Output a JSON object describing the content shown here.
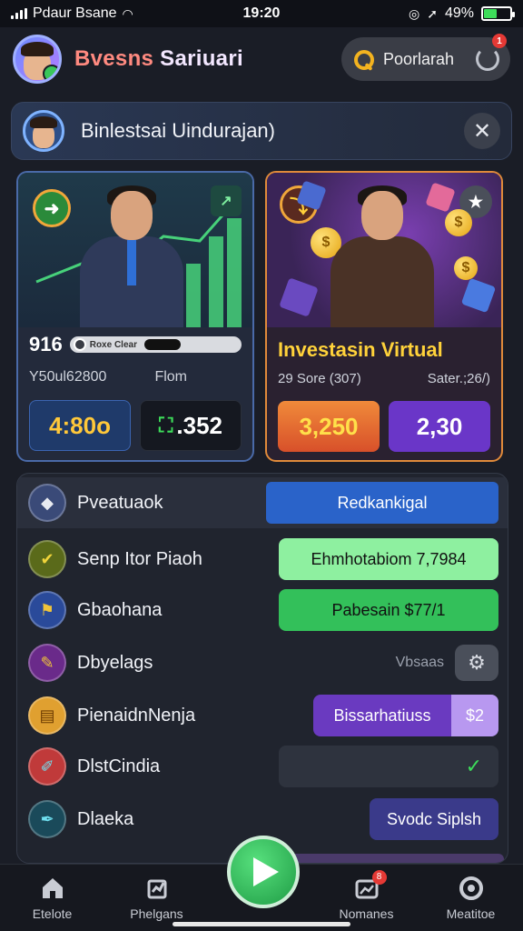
{
  "status_bar": {
    "carrier": "Pdaur Bsane",
    "time": "19:20",
    "battery": "49%",
    "battery_level": 0.49
  },
  "header": {
    "title_prefix": "Bvesns",
    "title_suffix": " Sariuari",
    "search_placeholder": "Poorlarah",
    "notification_count": "1"
  },
  "banner": {
    "title": "Binlestsai Uindurajan)",
    "close_glyph": "✕"
  },
  "card_left": {
    "value": "916",
    "slider_text": "Roxe Clear",
    "slider_level": 0.72,
    "sub_left": "Y50ul62800",
    "sub_right": "Flom",
    "btn1": "4:80o",
    "btn2": ".352",
    "btn2_icon": "⛶"
  },
  "card_right": {
    "title": "Investasin Virtual",
    "sub_left": "29 Sore (307)",
    "sub_right": "Sater.;26/)",
    "btn1": "3,250",
    "btn2": "2,30"
  },
  "list": {
    "head_label": "Pveatuaok",
    "head_button": "Redkankigal",
    "rows": [
      {
        "label": "Senp Itor Piaoh",
        "button": "Ehmhotabiom 7,7984",
        "icon": "✔"
      },
      {
        "label": "Gbaohana",
        "button": "Pabesain $77/1",
        "icon": "⚑"
      },
      {
        "label": "Dbyelags",
        "button": "Vbsaas",
        "icon": "✎"
      },
      {
        "label": "PienaidnNenja",
        "button": "Bissarhatiuss",
        "button2": "$2",
        "icon": "▤"
      },
      {
        "label": "DlstCindia",
        "button": "✓",
        "icon": "✐"
      },
      {
        "label": "Dlaeka",
        "button": "Svodc Siplsh",
        "icon": "✒"
      }
    ]
  },
  "nav": {
    "items": [
      "Etelote",
      "Phelgans",
      "Nomanes",
      "Meatitoe"
    ],
    "badge": "8"
  },
  "colors": {
    "accent_green": "#3ac65a",
    "accent_blue": "#2a63c9",
    "accent_orange": "#e9742b",
    "accent_purple": "#6a36c8"
  }
}
